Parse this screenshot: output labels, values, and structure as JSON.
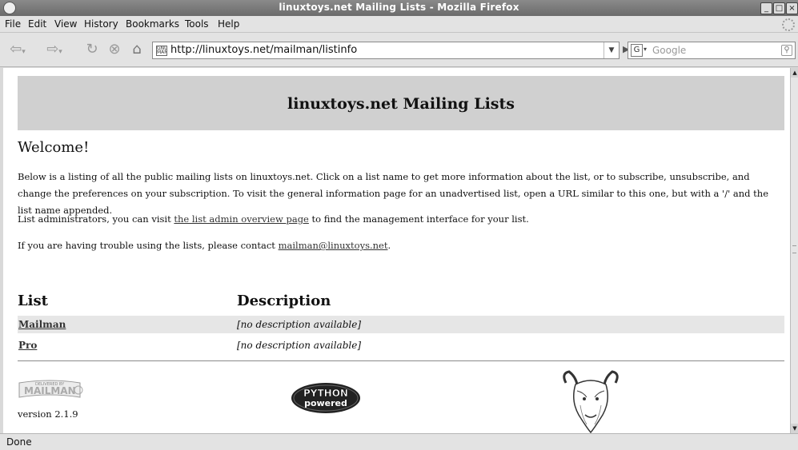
{
  "window": {
    "title": "linuxtoys.net Mailing Lists - Mozilla Firefox"
  },
  "menu": [
    "File",
    "Edit",
    "View",
    "History",
    "Bookmarks",
    "Tools",
    "Help"
  ],
  "nav": {
    "url": "http://linuxtoys.net/mailman/listinfo",
    "search_placeholder": "Google"
  },
  "page": {
    "heading": "linuxtoys.net Mailing Lists",
    "welcome": "Welcome!",
    "intro": "Below is a listing of all the public mailing lists on linuxtoys.net. Click on a list name to get more information about the list, or to subscribe, unsubscribe, and change the preferences on your subscription. To visit the general information page for an unadvertised list, open a URL similar to this one, but with a '/' and the list name appended.",
    "admin_prefix": "List administrators, you can visit ",
    "admin_link": "the list admin overview page",
    "admin_suffix": " to find the management interface for your list.",
    "trouble_prefix": "If you are having trouble using the lists, please contact ",
    "trouble_link": "mailman@linuxtoys.net",
    "trouble_suffix": ".",
    "col_list": "List",
    "col_description": "Description",
    "rows": [
      {
        "name": "Mailman",
        "description": "[no description available]"
      },
      {
        "name": "Pro",
        "description": "[no description available]"
      }
    ],
    "mailman_logo_text": "MAILMAN",
    "mailman_logo_small": "DELIVERED BY",
    "python_logo_top": "PYTHON",
    "python_logo_bottom": "powered",
    "version": "version 2.1.9"
  },
  "status": {
    "text": "Done"
  }
}
